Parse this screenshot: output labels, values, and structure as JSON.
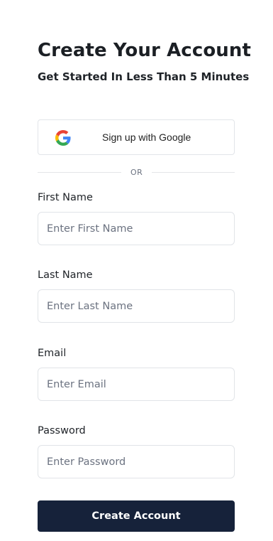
{
  "header": {
    "title": "Create Your Account",
    "subtitle": "Get Started In Less Than 5 Minutes"
  },
  "google": {
    "icon": "google-icon",
    "label": "Sign up with Google"
  },
  "divider": {
    "text": "OR"
  },
  "form": {
    "first_name": {
      "label": "First Name",
      "placeholder": "Enter First Name",
      "value": ""
    },
    "last_name": {
      "label": "Last Name",
      "placeholder": "Enter Last Name",
      "value": ""
    },
    "email": {
      "label": "Email",
      "placeholder": "Enter Email",
      "value": ""
    },
    "password": {
      "label": "Password",
      "placeholder": "Enter Password",
      "value": ""
    }
  },
  "submit": {
    "label": "Create Account"
  },
  "colors": {
    "button_bg": "#16223a",
    "border": "#e1e4e8",
    "text": "#1f2328",
    "placeholder": "#6b7280"
  }
}
